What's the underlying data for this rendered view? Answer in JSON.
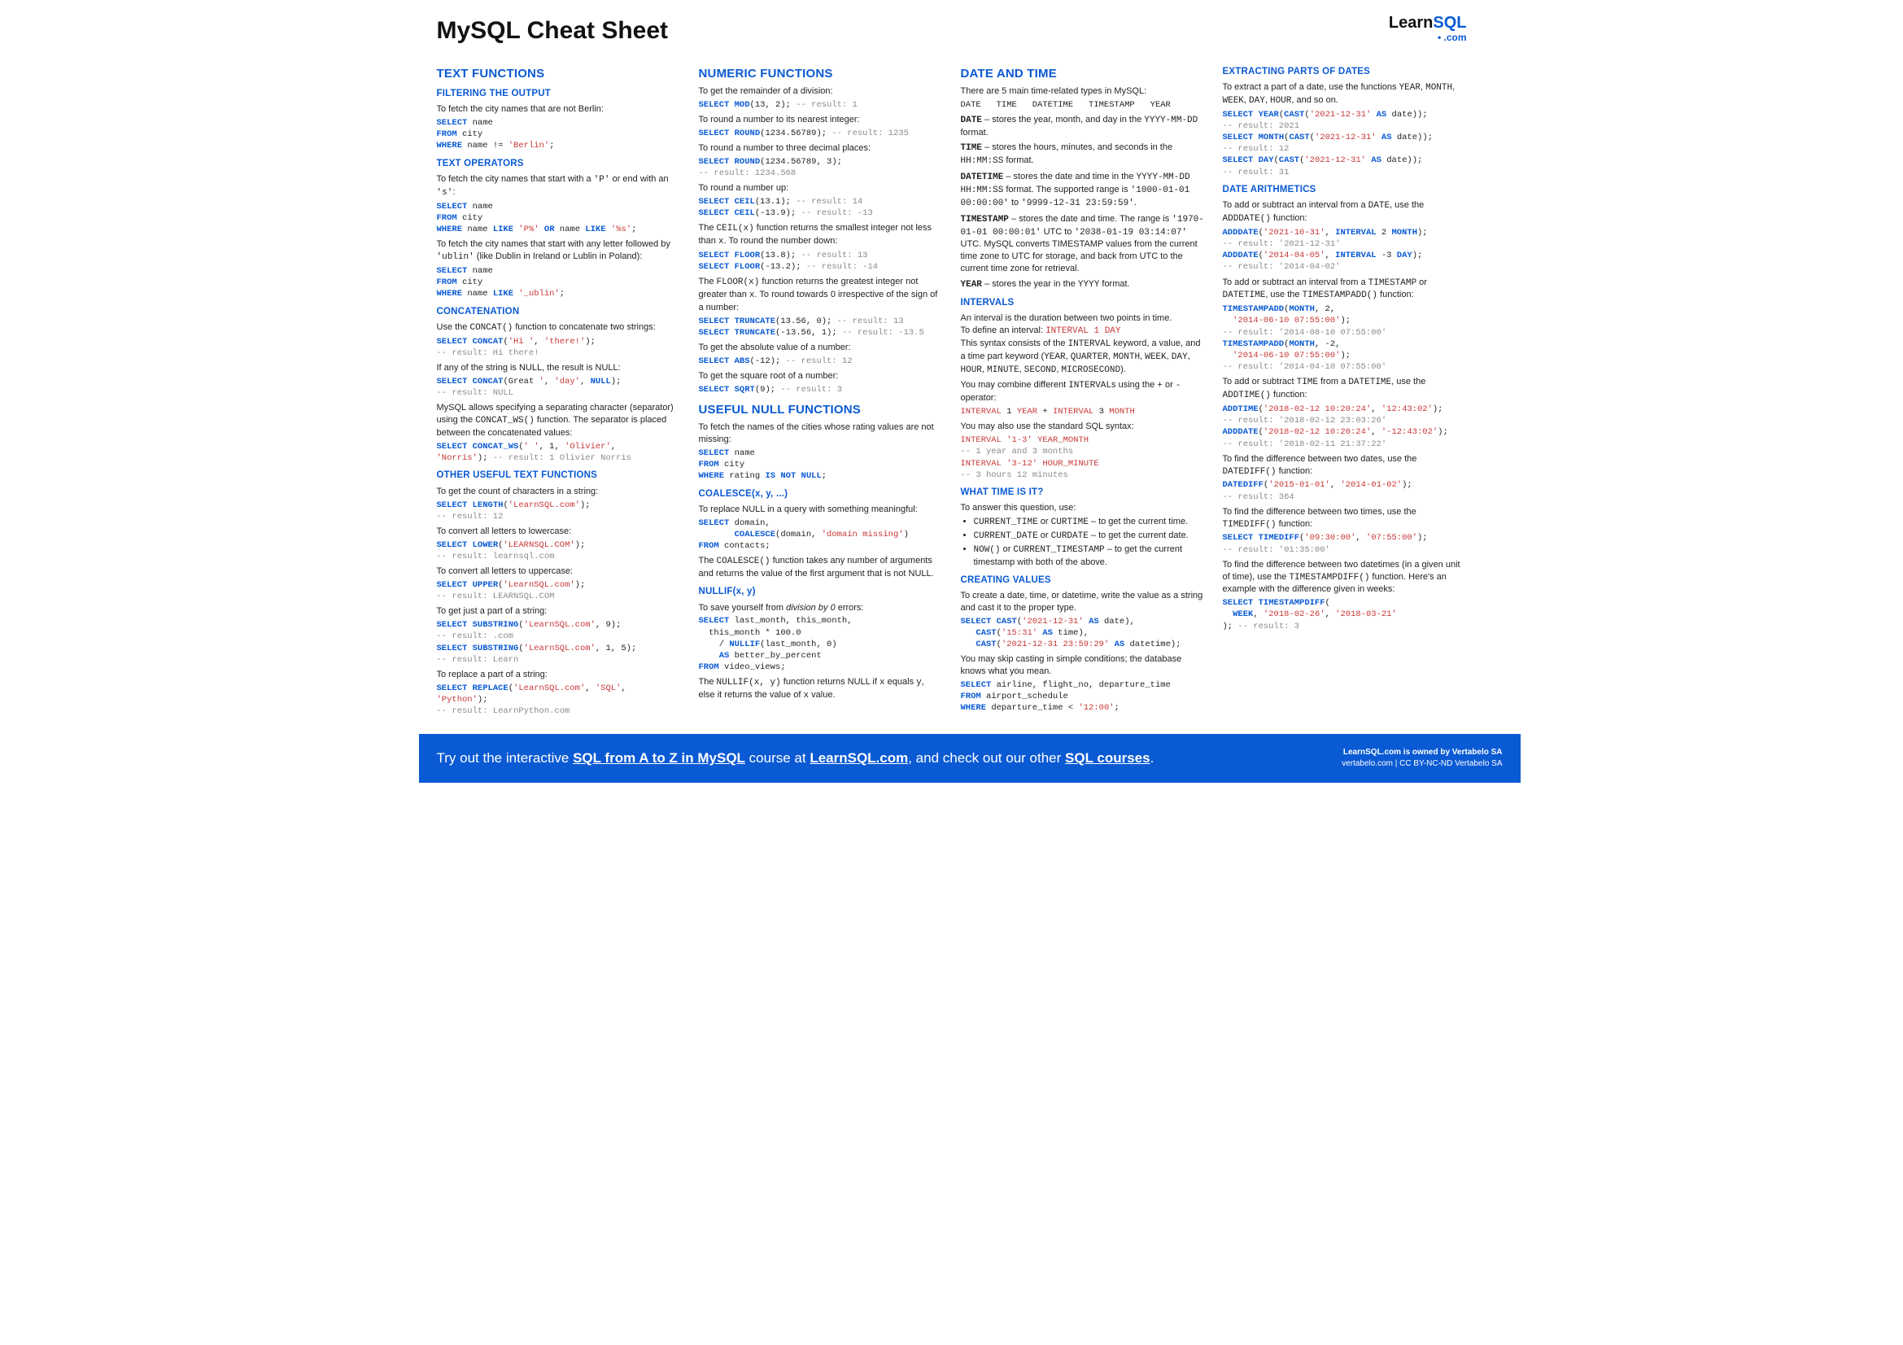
{
  "page_title": "MySQL Cheat Sheet",
  "logo": {
    "learn": "Learn",
    "sql": "SQL",
    "com": ".com"
  },
  "col1": {
    "h_text": "TEXT FUNCTIONS",
    "h_filter": "FILTERING THE OUTPUT",
    "p_filter": "To fetch the city names that are not Berlin:",
    "c_filter": "<span class='kw'>SELECT</span> name\n<span class='kw'>FROM</span> city\n<span class='kw'>WHERE</span> name != <span class='str'>'Berlin'</span>;",
    "h_ops": "TEXT OPERATORS",
    "p_ops1": "To fetch the city names that start with a <span class='mono'>'P'</span> or end with an <span class='mono'>'s'</span>:",
    "c_ops1": "<span class='kw'>SELECT</span> name\n<span class='kw'>FROM</span> city\n<span class='kw'>WHERE</span> name <span class='kw'>LIKE</span> <span class='str'>'P%'</span> <span class='kw'>OR</span> name <span class='kw'>LIKE</span> <span class='str'>'%s'</span>;",
    "p_ops2": "To fetch the city names that start with any letter followed by <span class='mono'>'ublin'</span> (like Dublin in Ireland or Lublin in Poland):",
    "c_ops2": "<span class='kw'>SELECT</span> name\n<span class='kw'>FROM</span> city\n<span class='kw'>WHERE</span> name <span class='kw'>LIKE</span> <span class='str'>'_ublin'</span>;",
    "h_concat": "CONCATENATION",
    "p_concat1": "Use the <span class='mono'>CONCAT()</span> function to concatenate two strings:",
    "c_concat1": "<span class='kw'>SELECT</span> <span class='fn'>CONCAT</span>(<span class='str'>'Hi '</span>, <span class='str'>'there!'</span>);\n<span class='cm'>-- result: Hi there!</span>",
    "p_concat2": "If any of the string is NULL, the result is NULL:",
    "c_concat2": "<span class='kw'>SELECT</span> <span class='fn'>CONCAT</span>(Great <span class='str'>'</span>, <span class='str'>'day'</span>, <span class='kw'>NULL</span>);\n<span class='cm'>-- result: NULL</span>",
    "p_concat3": "MySQL allows specifying a separating character (separator) using the <span class='mono'>CONCAT_WS()</span> function. The separator is placed between the concatenated values:",
    "c_concat3": "<span class='kw'>SELECT</span> <span class='fn'>CONCAT_WS</span>(<span class='str'>' '</span>, 1, <span class='str'>'Olivier'</span>,\n<span class='str'>'Norris'</span>); <span class='cm'>-- result: 1 Olivier Norris</span>",
    "h_other": "OTHER USEFUL TEXT FUNCTIONS",
    "p_len": "To get the count of characters in a string:",
    "c_len": "<span class='kw'>SELECT</span> <span class='fn'>LENGTH</span>(<span class='str'>'LearnSQL.com'</span>);\n<span class='cm'>-- result: 12</span>",
    "p_lower": "To convert all letters to lowercase:",
    "c_lower": "<span class='kw'>SELECT</span> <span class='fn'>LOWER</span>(<span class='str'>'LEARNSQL.COM'</span>);\n<span class='cm'>-- result: learnsql.com</span>",
    "p_upper": "To convert all letters to uppercase:",
    "c_upper": "<span class='kw'>SELECT</span> <span class='fn'>UPPER</span>(<span class='str'>'LearnSQL.com'</span>);\n<span class='cm'>-- result: LEARNSQL.COM</span>",
    "p_sub": "To get just a part of a string:",
    "c_sub": "<span class='kw'>SELECT</span> <span class='fn'>SUBSTRING</span>(<span class='str'>'LearnSQL.com'</span>, 9);\n<span class='cm'>-- result: .com</span>\n<span class='kw'>SELECT</span> <span class='fn'>SUBSTRING</span>(<span class='str'>'LearnSQL.com'</span>, 1, 5);\n<span class='cm'>-- result: Learn</span>",
    "p_rep": "To replace a part of a string:",
    "c_rep": "<span class='kw'>SELECT</span> <span class='fn'>REPLACE</span>(<span class='str'>'LearnSQL.com'</span>, <span class='str'>'SQL'</span>,\n<span class='str'>'Python'</span>);\n<span class='cm'>-- result: LearnPython.com</span>"
  },
  "col2": {
    "h_num": "NUMERIC FUNCTIONS",
    "p_mod": "To get the remainder of a division:",
    "c_mod": "<span class='kw'>SELECT</span> <span class='fn'>MOD</span>(13, 2); <span class='cm'>-- result: 1</span>",
    "p_round1": "To round a number to its nearest integer:",
    "c_round1": "<span class='kw'>SELECT</span> <span class='fn'>ROUND</span>(1234.56789); <span class='cm'>-- result: 1235</span>",
    "p_round2": "To round a number to three decimal places:",
    "c_round2": "<span class='kw'>SELECT</span> <span class='fn'>ROUND</span>(1234.56789, 3);\n<span class='cm'>-- result: 1234.568</span>",
    "p_ceil": "To round a number up:",
    "c_ceil": "<span class='kw'>SELECT</span> <span class='fn'>CEIL</span>(13.1); <span class='cm'>-- result: 14</span>\n<span class='kw'>SELECT</span> <span class='fn'>CEIL</span>(-13.9); <span class='cm'>-- result: -13</span>",
    "p_ceil2": "The <span class='mono'>CEIL(x)</span> function returns the smallest integer not less than <span class='mono'>x</span>. To round the number down:",
    "c_floor": "<span class='kw'>SELECT</span> <span class='fn'>FLOOR</span>(13.8); <span class='cm'>-- result: 13</span>\n<span class='kw'>SELECT</span> <span class='fn'>FLOOR</span>(-13.2); <span class='cm'>-- result: -14</span>",
    "p_floor2": "The <span class='mono'>FLOOR(x)</span> function returns the greatest integer not greater than <span class='mono'>x</span>. To round towards 0 irrespective of the sign of a number:",
    "c_trunc": "<span class='kw'>SELECT</span> <span class='fn'>TRUNCATE</span>(13.56, 0); <span class='cm'>-- result: 13</span>\n<span class='kw'>SELECT</span> <span class='fn'>TRUNCATE</span>(-13.56, 1); <span class='cm'>-- result: -13.5</span>",
    "p_abs": "To get the absolute value of a number:",
    "c_abs": "<span class='kw'>SELECT</span> <span class='fn'>ABS</span>(-12); <span class='cm'>-- result: 12</span>",
    "p_sqrt": "To get the square root of a number:",
    "c_sqrt": "<span class='kw'>SELECT</span> <span class='fn'>SQRT</span>(9); <span class='cm'>-- result: 3</span>",
    "h_null": "USEFUL NULL FUNCTIONS",
    "p_null1": "To fetch the names of the cities whose rating values are not missing:",
    "c_null1": "<span class='kw'>SELECT</span> name\n<span class='kw'>FROM</span> city\n<span class='kw'>WHERE</span> rating <span class='kw'>IS NOT NULL</span>;",
    "h_coal": "COALESCE(x, y, ...)",
    "p_coal": "To replace NULL in a query with something meaningful:",
    "c_coal": "<span class='kw'>SELECT</span> domain,\n       <span class='fn'>COALESCE</span>(domain, <span class='str'>'domain missing'</span>)\n<span class='kw'>FROM</span> contacts;",
    "p_coal2": "The <span class='mono'>COALESCE()</span> function takes any number of arguments and returns the value of the first argument that is not NULL.",
    "h_nullif": "NULLIF(x, y)",
    "p_nullif": "To save yourself from <i>division by 0</i> errors:",
    "c_nullif": "<span class='kw'>SELECT</span> last_month, this_month,\n  this_month * 100.0\n    / <span class='fn'>NULLIF</span>(last_month, 0)\n    <span class='kw'>AS</span> better_by_percent\n<span class='kw'>FROM</span> video_views;",
    "p_nullif2": "The <span class='mono'>NULLIF(x, y)</span> function returns NULL if <span class='mono'>x</span> equals <span class='mono'>y</span>, else it returns the value of <span class='mono'>x</span> value."
  },
  "col3": {
    "h_dt": "DATE AND TIME",
    "p_dt1": "There are 5 main time-related types in MySQL:",
    "c_dt1": "DATE   TIME   DATETIME   TIMESTAMP   YEAR",
    "p_date": "<b><span class='mono'>DATE</span></b> – stores the year, month, and day in the <span class='mono'>YYYY-MM-DD</span> format.",
    "p_time": "<b><span class='mono'>TIME</span></b> – stores the hours, minutes, and seconds in the <span class='mono'>HH:MM:SS</span> format.",
    "p_datetime": "<b><span class='mono'>DATETIME</span></b> – stores the date and time in the <span class='mono'>YYYY-MM-DD HH:MM:SS</span> format. The supported range is <span class='mono'>'1000-01-01 00:00:00'</span> to <span class='mono'>'9999-12-31 23:59:59'</span>.",
    "p_ts": "<b><span class='mono'>TIMESTAMP</span></b> – stores the date and time. The range is <span class='mono'>'1970-01-01 00:00:01'</span> UTC to <span class='mono'>'2038-01-19 03:14:07'</span> UTC. MySQL converts TIMESTAMP values from the current time zone to UTC for storage, and back from UTC to the current time zone for retrieval.",
    "p_year": "<b><span class='mono'>YEAR</span></b> – stores the year in the <span class='mono'>YYYY</span> format.",
    "h_int": "INTERVALS",
    "p_int1": "An interval is the duration between two points in time.<br>To define an interval: <span class='mono str'>INTERVAL 1 DAY</span><br>This syntax consists of the <span class='mono'>INTERVAL</span> keyword, a value, and a time part keyword (<span class='mono'>YEAR</span>, <span class='mono'>QUARTER</span>, <span class='mono'>MONTH</span>, <span class='mono'>WEEK</span>, <span class='mono'>DAY</span>, <span class='mono'>HOUR</span>, <span class='mono'>MINUTE</span>, <span class='mono'>SECOND</span>, <span class='mono'>MICROSECOND</span>).",
    "p_int2": "You may combine different <span class='mono'>INTERVAL</span>s using the <span class='mono'>+</span> or <span class='mono'>-</span> operator:",
    "c_int2": "<span class='str'>INTERVAL</span> 1 <span class='str'>YEAR</span> + <span class='str'>INTERVAL</span> 3 <span class='str'>MONTH</span>",
    "p_int3": "You may also use the standard SQL syntax:",
    "c_int3": "<span class='str'>INTERVAL</span> <span class='str'>'1-3'</span> <span class='str'>YEAR_MONTH</span>\n<span class='cm'>-- 1 year and 3 months</span>\n<span class='str'>INTERVAL</span> <span class='str'>'3-12'</span> <span class='str'>HOUR_MINUTE</span>\n<span class='cm'>-- 3 hours 12 minutes</span>",
    "h_what": "WHAT TIME IS IT?",
    "p_what": "To answer this question, use:",
    "li1": "<span class='mono'>CURRENT_TIME</span> or <span class='mono'>CURTIME</span> – to get the current time.",
    "li2": "<span class='mono'>CURRENT_DATE</span> or <span class='mono'>CURDATE</span> – to get the current date.",
    "li3": "<span class='mono'>NOW()</span> or <span class='mono'>CURRENT_TIMESTAMP</span> – to get the current timestamp with both of the above.",
    "h_create": "CREATING VALUES",
    "p_create1": "To create a date, time, or datetime, write the value as a string and cast it to the proper type.",
    "c_create1": "<span class='kw'>SELECT</span> <span class='fn'>CAST</span>(<span class='str'>'2021-12-31'</span> <span class='kw'>AS</span> date),\n   <span class='fn'>CAST</span>(<span class='str'>'15:31'</span> <span class='kw'>AS</span> time),\n   <span class='fn'>CAST</span>(<span class='str'>'2021-12-31 23:59:29'</span> <span class='kw'>AS</span> datetime);",
    "p_create2": "You may skip casting in simple conditions; the database knows what you mean.",
    "c_create2": "<span class='kw'>SELECT</span> airline, flight_no, departure_time\n<span class='kw'>FROM</span> airport_schedule\n<span class='kw'>WHERE</span> departure_time &lt; <span class='str'>'12:00'</span>;"
  },
  "col4": {
    "h_ext": "EXTRACTING PARTS OF DATES",
    "p_ext": "To extract a part of a date, use the functions <span class='mono'>YEAR</span>, <span class='mono'>MONTH</span>, <span class='mono'>WEEK</span>, <span class='mono'>DAY</span>, <span class='mono'>HOUR</span>, and so on.",
    "c_ext": "<span class='kw'>SELECT</span> <span class='fn'>YEAR</span>(<span class='fn'>CAST</span>(<span class='str'>'2021-12-31'</span> <span class='kw'>AS</span> date));\n<span class='cm'>-- result: 2021</span>\n<span class='kw'>SELECT</span> <span class='fn'>MONTH</span>(<span class='fn'>CAST</span>(<span class='str'>'2021-12-31'</span> <span class='kw'>AS</span> date));\n<span class='cm'>-- result: 12</span>\n<span class='kw'>SELECT</span> <span class='fn'>DAY</span>(<span class='fn'>CAST</span>(<span class='str'>'2021-12-31'</span> <span class='kw'>AS</span> date));\n<span class='cm'>-- result: 31</span>",
    "h_arith": "DATE ARITHMETICS",
    "p_add1": "To add or subtract an interval from a <span class='mono'>DATE</span>, use the <span class='mono'>ADDDATE()</span> function:",
    "c_add1": "<span class='fn'>ADDDATE</span>(<span class='str'>'2021-10-31'</span>, <span class='kw'>INTERVAL</span> 2 <span class='kw'>MONTH</span>);\n<span class='cm'>-- result: '2021-12-31'</span>\n<span class='fn'>ADDDATE</span>(<span class='str'>'2014-04-05'</span>, <span class='kw'>INTERVAL</span> -3 <span class='kw'>DAY</span>);\n<span class='cm'>-- result: '2014-04-02'</span>",
    "p_add2": "To add or subtract an interval from a <span class='mono'>TIMESTAMP</span> or <span class='mono'>DATETIME</span>, use the <span class='mono'>TIMESTAMPADD()</span> function:",
    "c_add2": "<span class='fn'>TIMESTAMPADD</span>(<span class='kw'>MONTH</span>, 2,\n  <span class='str'>'2014-06-10 07:55:00'</span>);\n<span class='cm'>-- result: '2014-08-10 07:55:00'</span>\n<span class='fn'>TIMESTAMPADD</span>(<span class='kw'>MONTH</span>, -2,\n  <span class='str'>'2014-06-10 07:55:00'</span>);\n<span class='cm'>-- result: '2014-04-10 07:55:00'</span>",
    "p_add3": "To add or subtract <span class='mono'>TIME</span> from a <span class='mono'>DATETIME</span>, use the <span class='mono'>ADDTIME()</span> function:",
    "c_add3": "<span class='fn'>ADDTIME</span>(<span class='str'>'2018-02-12 10:20:24'</span>, <span class='str'>'12:43:02'</span>);\n<span class='cm'>-- result: '2018-02-12 23:03:26'</span>\n<span class='fn'>ADDDATE</span>(<span class='str'>'2018-02-12 10:20:24'</span>, <span class='str'>'-12:43:02'</span>);\n<span class='cm'>-- result: '2018-02-11 21:37:22'</span>",
    "p_diff1": "To find the difference between two dates, use the <span class='mono'>DATEDIFF()</span> function:",
    "c_diff1": "<span class='fn'>DATEDIFF</span>(<span class='str'>'2015-01-01'</span>, <span class='str'>'2014-01-02'</span>);\n<span class='cm'>-- result: 364</span>",
    "p_diff2": "To find the difference between two times, use the <span class='mono'>TIMEDIFF()</span> function:",
    "c_diff2": "<span class='kw'>SELECT</span> <span class='fn'>TIMEDIFF</span>(<span class='str'>'09:30:00'</span>, <span class='str'>'07:55:00'</span>);\n<span class='cm'>-- result: '01:35:00'</span>",
    "p_diff3": "To find the difference between two datetimes (in a given unit of time), use the <span class='mono'>TIMESTAMPDIFF()</span> function. Here's an example with the difference given in weeks:",
    "c_diff3": "<span class='kw'>SELECT</span> <span class='fn'>TIMESTAMPDIFF</span>(\n  <span class='kw'>WEEK</span>, <span class='str'>'2018-02-26'</span>, <span class='str'>'2018-03-21'</span>\n); <span class='cm'>-- result: 3</span>"
  },
  "footer": {
    "left": "Try out the interactive <span class='flink'>SQL from A to Z in MySQL</span> course at <span class='flink'>LearnSQL.com</span>, and check out our other <span class='flink'>SQL courses</span>.",
    "r1": "LearnSQL.com is owned by Vertabelo SA",
    "r2": "vertabelo.com | CC BY-NC-ND Vertabelo SA"
  }
}
